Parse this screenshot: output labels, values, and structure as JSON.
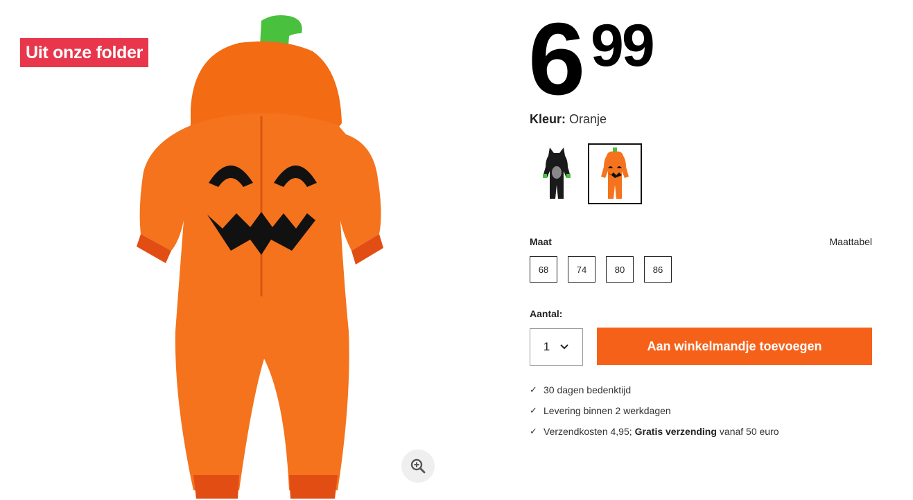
{
  "badge": {
    "label": "Uit onze folder",
    "color": "#e8374c"
  },
  "product": {
    "image_icon": "pumpkin-onesie-image",
    "zoom_icon": "zoom-in-icon"
  },
  "price": {
    "euros": "6",
    "cents": "99"
  },
  "color": {
    "label": "Kleur:",
    "value": "Oranje"
  },
  "color_swatches": [
    {
      "name": "black-onesie",
      "selected": false
    },
    {
      "name": "orange-pumpkin-onesie",
      "selected": true
    }
  ],
  "size": {
    "label": "Maat",
    "size_table_link": "Maattabel",
    "options": [
      "68",
      "74",
      "80",
      "86"
    ]
  },
  "quantity": {
    "label": "Aantal:",
    "value": "1"
  },
  "cart": {
    "button_label": "Aan winkelmandje toevoegen",
    "color": "#f6611a"
  },
  "usps": [
    {
      "text": "30 dagen bedenktijd"
    },
    {
      "text": "Levering binnen 2 werkdagen"
    },
    {
      "text_before": "Verzendkosten 4,95;",
      "bold": "Gratis verzending",
      "text_after": "vanaf 50 euro"
    }
  ]
}
